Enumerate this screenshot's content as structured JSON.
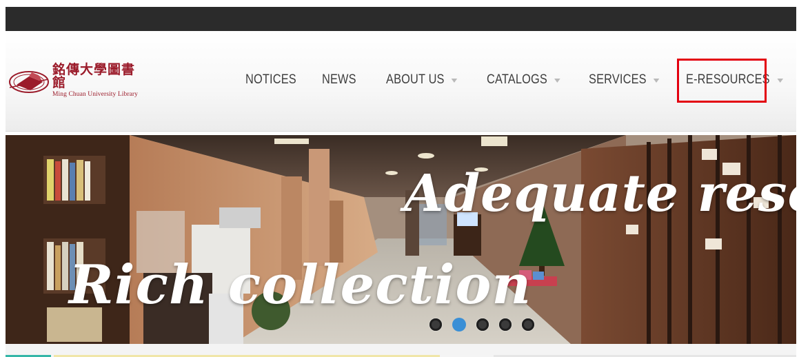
{
  "logo": {
    "chinese_name": "銘傳大學圖書館",
    "english_name": "Ming Chuan University Library"
  },
  "nav": {
    "items": [
      {
        "label": "NOTICES",
        "has_dropdown": false
      },
      {
        "label": "NEWS",
        "has_dropdown": false
      },
      {
        "label": "ABOUT US",
        "has_dropdown": true
      },
      {
        "label": "CATALOGS",
        "has_dropdown": true
      },
      {
        "label": "SERVICES",
        "has_dropdown": true
      },
      {
        "label": "E-RESOURCES",
        "has_dropdown": true
      }
    ],
    "highlighted_item": "E-RESOURCES"
  },
  "slider": {
    "captions": [
      "Adequate resources",
      "Rich collection"
    ],
    "dot_count": 5,
    "active_dot": 2
  },
  "colors": {
    "top_bar": "#2b2b2b",
    "brand_red": "#9b1b2a",
    "highlight_outline": "#e3000f",
    "active_dot": "#3a8fd6",
    "nav_text": "#3e3e3e"
  }
}
